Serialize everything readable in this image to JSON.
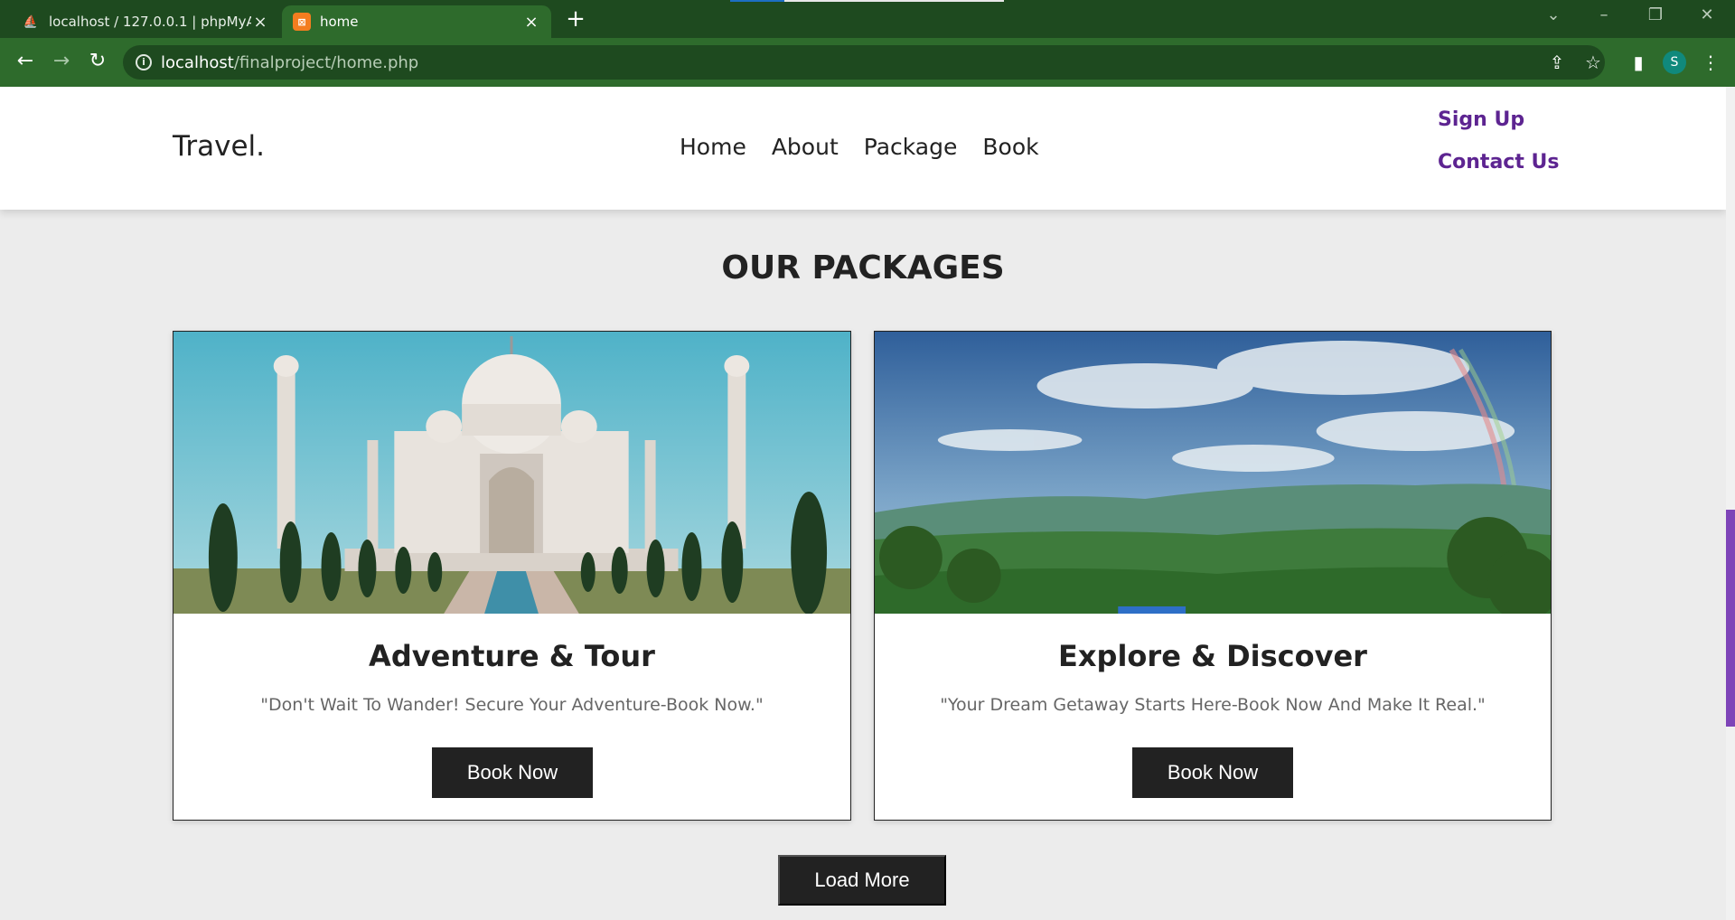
{
  "browser": {
    "tabs": [
      {
        "title": "localhost / 127.0.0.1 | phpMyAdm",
        "favicon": "phpmyadmin-icon",
        "active": false
      },
      {
        "title": "home",
        "favicon": "xampp-icon",
        "active": true
      }
    ],
    "new_tab": "+",
    "url_host": "localhost",
    "url_path": "/finalproject/home.php",
    "profile_initial": "S",
    "colors": {
      "frame": "#1e4a1f",
      "toolbar": "#2e6b2c",
      "profile": "#10897c"
    }
  },
  "site": {
    "logo": "Travel.",
    "nav": [
      "Home",
      "About",
      "Package",
      "Book"
    ],
    "right_links": [
      "Sign Up",
      "Contact Us"
    ],
    "accent": "#5d2491"
  },
  "packages": {
    "heading": "OUR PACKAGES",
    "cards": [
      {
        "title": "Adventure & Tour",
        "tagline": "\"Don't Wait To Wander! Secure Your Adventure-Book Now.\"",
        "button": "Book Now",
        "image": "taj-mahal-photo"
      },
      {
        "title": "Explore & Discover",
        "tagline": "\"Your Dream Getaway Starts Here-Book Now And Make It Real.\"",
        "button": "Book Now",
        "image": "mountain-valley-photo"
      }
    ],
    "load_more": "Load More"
  }
}
